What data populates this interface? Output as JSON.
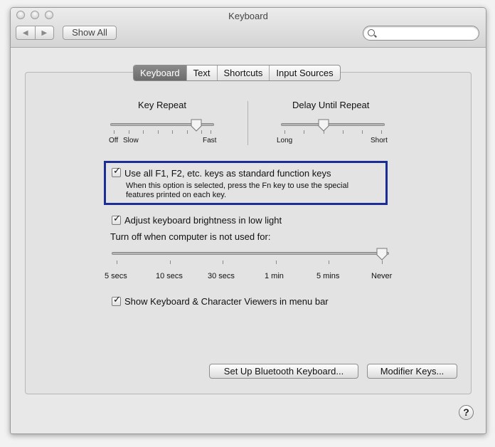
{
  "window": {
    "title": "Keyboard"
  },
  "toolbar": {
    "back_glyph": "◀",
    "forward_glyph": "▶",
    "show_all_label": "Show All",
    "search_placeholder": "",
    "search_value": ""
  },
  "tabs": [
    {
      "label": "Keyboard",
      "active": true
    },
    {
      "label": "Text",
      "active": false
    },
    {
      "label": "Shortcuts",
      "active": false
    },
    {
      "label": "Input Sources",
      "active": false
    }
  ],
  "key_repeat": {
    "title": "Key Repeat",
    "left_labels": [
      "Off",
      "Slow"
    ],
    "right_label": "Fast"
  },
  "delay_repeat": {
    "title": "Delay Until Repeat",
    "left_label": "Long",
    "right_label": "Short"
  },
  "fn_keys": {
    "label": "Use all F1, F2, etc. keys as standard function keys",
    "checked": true,
    "help_line1": "When this option is selected, press the Fn key to use the special",
    "help_line2": "features printed on each key."
  },
  "brightness": {
    "label": "Adjust keyboard brightness in low light",
    "checked": true
  },
  "turn_off": {
    "label": "Turn off when computer is not used for:",
    "ticks": [
      "5 secs",
      "10 secs",
      "30 secs",
      "1 min",
      "5 mins",
      "Never"
    ]
  },
  "viewers": {
    "label": "Show Keyboard & Character Viewers in menu bar",
    "checked": true
  },
  "buttons": {
    "bluetooth": "Set Up Bluetooth Keyboard...",
    "modifier": "Modifier Keys..."
  },
  "help_glyph": "?"
}
